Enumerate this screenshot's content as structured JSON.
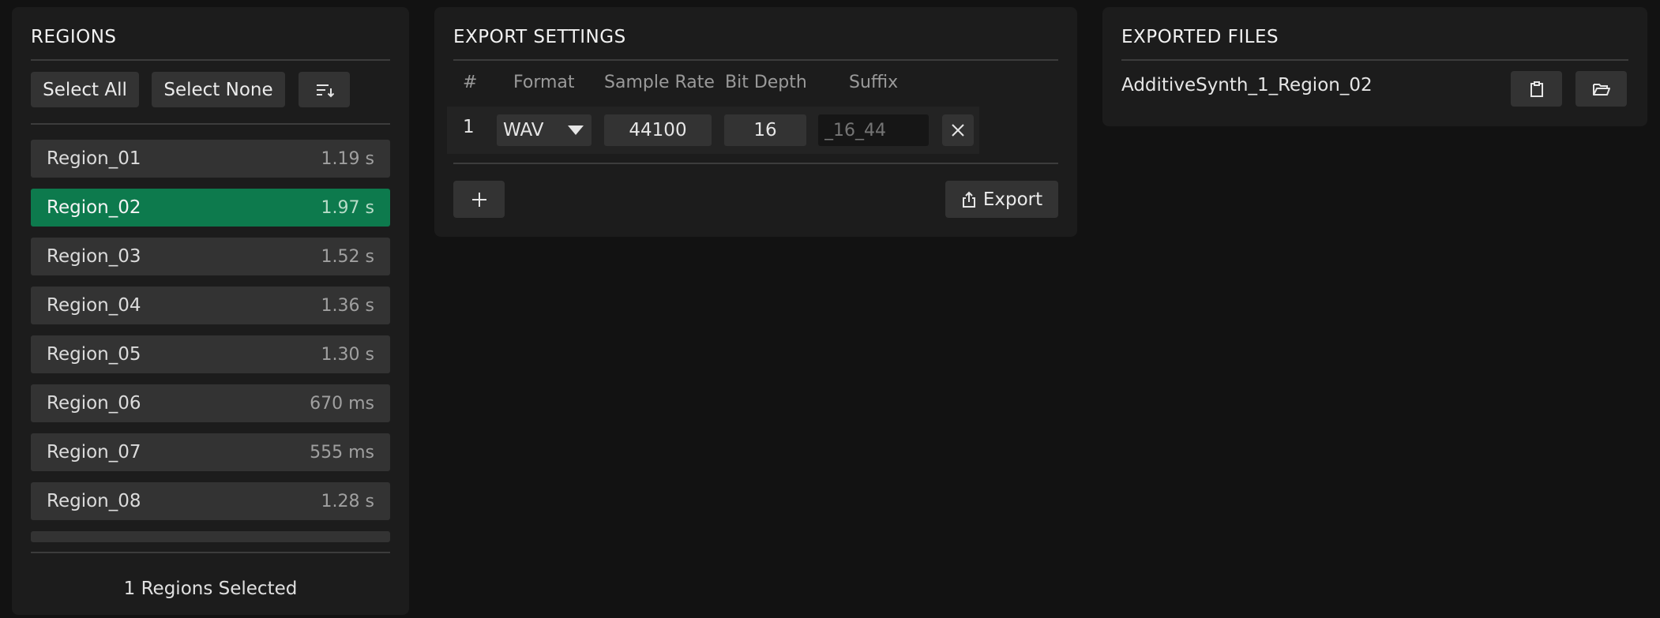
{
  "regions_panel": {
    "title": "REGIONS",
    "select_all_label": "Select All",
    "select_none_label": "Select None",
    "sort_icon": "sort-icon",
    "items": [
      {
        "name": "Region_01",
        "duration": "1.19 s",
        "selected": false
      },
      {
        "name": "Region_02",
        "duration": "1.97 s",
        "selected": true
      },
      {
        "name": "Region_03",
        "duration": "1.52 s",
        "selected": false
      },
      {
        "name": "Region_04",
        "duration": "1.36 s",
        "selected": false
      },
      {
        "name": "Region_05",
        "duration": "1.30 s",
        "selected": false
      },
      {
        "name": "Region_06",
        "duration": "670 ms",
        "selected": false
      },
      {
        "name": "Region_07",
        "duration": "555 ms",
        "selected": false
      },
      {
        "name": "Region_08",
        "duration": "1.28 s",
        "selected": false
      }
    ],
    "status": "1 Regions Selected"
  },
  "export_settings": {
    "title": "EXPORT SETTINGS",
    "columns": {
      "index": "#",
      "format": "Format",
      "sample_rate": "Sample Rate",
      "bit_depth": "Bit Depth",
      "suffix": "Suffix"
    },
    "rows": [
      {
        "index": "1",
        "format": "WAV",
        "sample_rate": "44100",
        "bit_depth": "16",
        "suffix_placeholder": "_16_44"
      }
    ],
    "export_label": "Export"
  },
  "exported_files": {
    "title": "EXPORTED FILES",
    "files": [
      {
        "name": "AdditiveSynth_1_Region_02"
      }
    ]
  },
  "colors": {
    "background": "#121212",
    "panel": "#1c1c1c",
    "control": "#333333",
    "selected": "#0d7a4d"
  }
}
